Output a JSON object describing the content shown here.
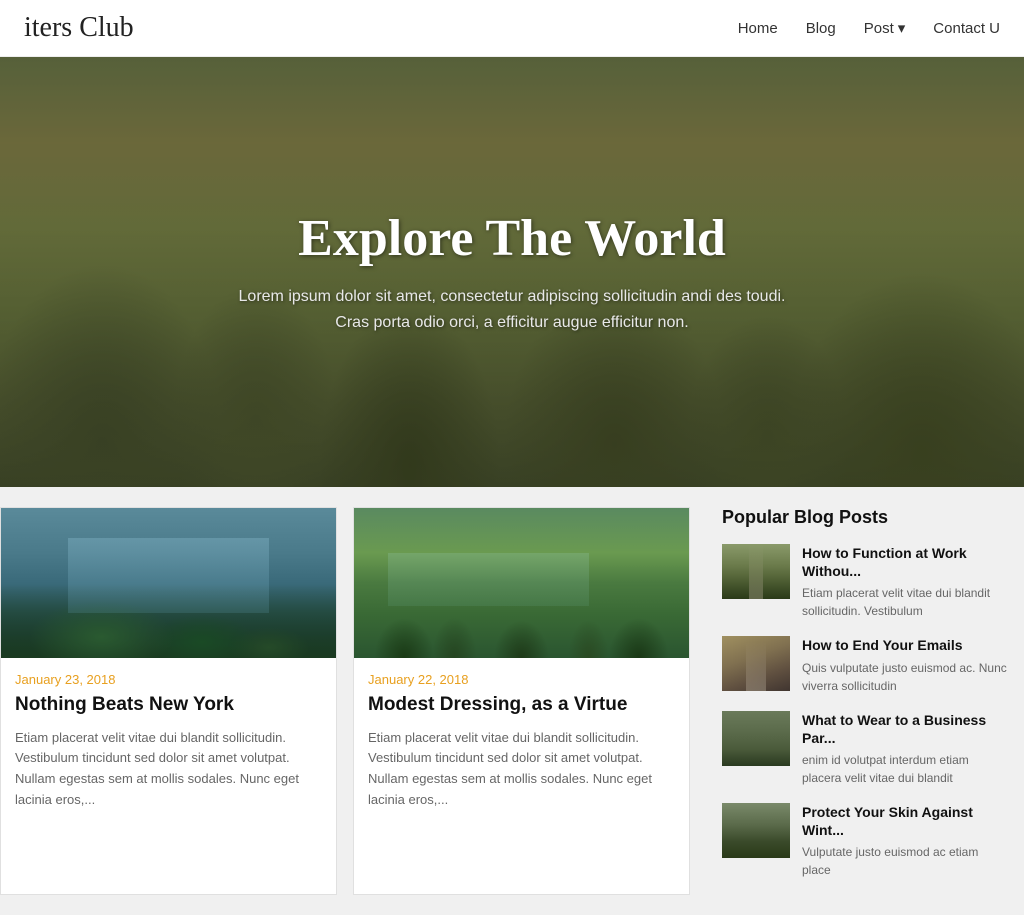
{
  "header": {
    "logo": "iters Club",
    "nav": {
      "home": "Home",
      "blog": "Blog",
      "post": "Post",
      "post_chevron": "▾",
      "contact": "Contact U"
    }
  },
  "hero": {
    "title": "Explore The World",
    "subtitle_line1": "Lorem ipsum dolor sit amet, consectetur adipiscing sollicitudin andi des toudi.",
    "subtitle_line2": "Cras porta odio orci, a efficitur augue efficitur non."
  },
  "blog_posts": [
    {
      "date": "January 23, 2018",
      "title": "Nothing Beats New York",
      "excerpt": "Etiam placerat velit vitae dui blandit sollicitudin. Vestibulum tincidunt sed dolor sit amet volutpat. Nullam egestas sem at mollis sodales. Nunc eget lacinia eros,..."
    },
    {
      "date": "January 22, 2018",
      "title": "Modest Dressing, as a Virtue",
      "excerpt": "Etiam placerat velit vitae dui blandit sollicitudin. Vestibulum tincidunt sed dolor sit amet volutpat. Nullam egestas sem at mollis sodales. Nunc eget lacinia eros,..."
    }
  ],
  "sidebar": {
    "title": "Popular Blog Posts",
    "posts": [
      {
        "title": "How to Function at Work Withou...",
        "excerpt": "Etiam placerat velit vitae dui blandit sollicitudin. Vestibulum"
      },
      {
        "title": "How to End Your Emails",
        "excerpt": "Quis vulputate justo euismod ac. Nunc viverra sollicitudin"
      },
      {
        "title": "What to Wear to a Business Par...",
        "excerpt": "enim id volutpat interdum etiam placera velit vitae dui blandit"
      },
      {
        "title": "Protect Your Skin Against Wint...",
        "excerpt": "Vulputate justo euismod ac etiam place"
      }
    ]
  }
}
